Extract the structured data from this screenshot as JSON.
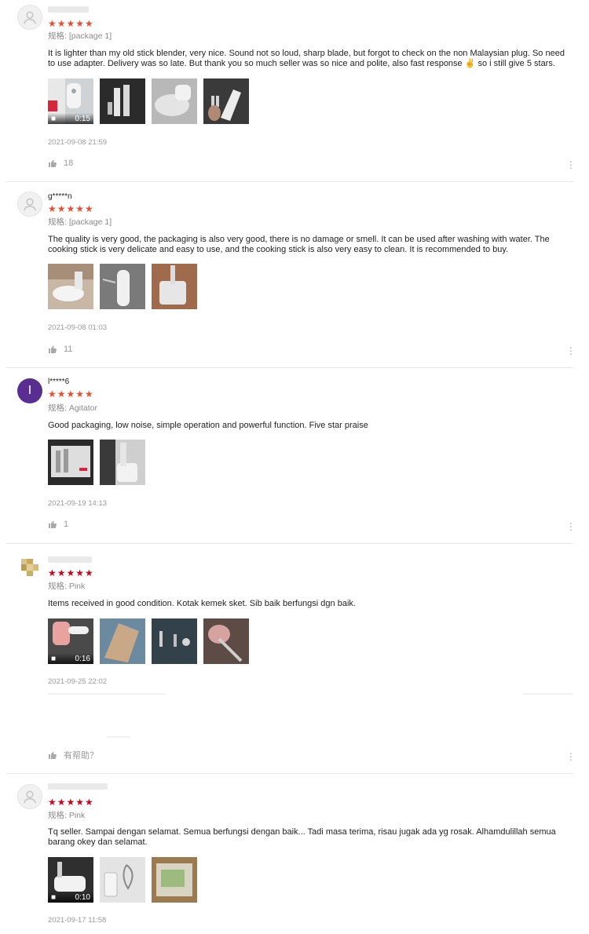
{
  "reviews": [
    {
      "username": "",
      "stars": "★★★★★",
      "variant": "规格: [package 1]",
      "text": "It is lighter than my old stick blender, very nice. Sound not so loud, sharp blade, but forgot to check on the non Malaysian plug. So need to use adapter. Delivery was so late. But thank you so much seller was so nice and polite, also fast response ✌️ so i still give 5 stars.",
      "video_duration": "0:15",
      "date": "2021-09-08 21:59",
      "likes": "18"
    },
    {
      "username": "g*****n",
      "stars": "★★★★★",
      "variant": "规格: [package 1]",
      "text": "The quality is very good, the packaging is also very good, there is no damage or smell. It can be used after washing with water. The cooking stick is very delicate and easy to use, and the cooking stick is also very easy to clean. It is recommended to buy.",
      "date": "2021-09-08 01:03",
      "likes": "11"
    },
    {
      "avatar_letter": "I",
      "username": "l*****6",
      "stars": "★★★★★",
      "variant": "规格: Agitator",
      "text": "Good packaging, low noise, simple operation and powerful function. Five star praise",
      "date": "2021-09-19 14:13",
      "likes": "1"
    },
    {
      "username": "",
      "stars": "★★★★★",
      "variant": "规格: Pink",
      "text": "Items received in good condition. Kotak kemek sket. Sib baik berfungsi dgn baik.",
      "video_duration": "0:16",
      "date": "2021-09-25 22:02",
      "likes": "有帮助？"
    },
    {
      "username": "",
      "stars": "★★★★★",
      "variant": "规格: Pink",
      "text": "Tq seller.  Sampai dengan selamat.  Semua berfungsi dengan baik...  Tadi masa terima,  risau jugak ada yg rosak.  Alhamdulillah semua barang okey dan selamat.",
      "video_duration": "0:10",
      "date": "2021-09-17 11:58"
    }
  ],
  "icons": {
    "avatar": "user-icon",
    "like": "thumbs-up-icon",
    "more": "more-vertical-icon",
    "video": "video-camera-icon"
  },
  "colors": {
    "star": "#ee4d2d",
    "star_alt": "#d0011b",
    "avatar_letter_bg": "#5a2d91"
  }
}
